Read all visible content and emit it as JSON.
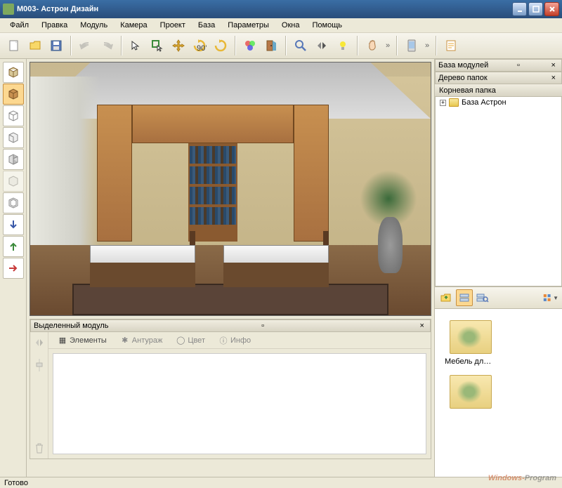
{
  "window": {
    "title": "М003- Астрон Дизайн"
  },
  "menu": {
    "items": [
      "Файл",
      "Правка",
      "Модуль",
      "Камера",
      "Проект",
      "База",
      "Параметры",
      "Окна",
      "Помощь"
    ]
  },
  "toolbar": {
    "new": "new-file",
    "open": "open-file",
    "save": "save-file",
    "undo": "undo",
    "redo": "redo",
    "select": "select",
    "selectbox": "select-box",
    "move": "move",
    "rotate90": "rotate-90",
    "rotate": "rotate",
    "colors": "color-wheel",
    "door": "door",
    "zoomin": "zoom-in",
    "mirror": "mirror",
    "light": "light",
    "hand": "pan-hand",
    "phone": "export-phone",
    "report": "report"
  },
  "left_tools": [
    "view-box",
    "box-solid",
    "box-wire",
    "box-open",
    "box-side",
    "box-transparent",
    "box-hollow",
    "arrow-down",
    "arrow-up",
    "arrow-right"
  ],
  "module_panel": {
    "title": "Выделенный модуль",
    "tabs": [
      "Элементы",
      "Антураж",
      "Цвет",
      "Инфо"
    ]
  },
  "right_panel": {
    "title_modules": "База модулей",
    "title_tree": "Дерево папок",
    "root_label": "Корневая папка",
    "tree_item": "База Астрон",
    "thumbs": [
      "Мебель для д...",
      ""
    ]
  },
  "status": {
    "text": "Готово"
  },
  "watermark": {
    "part1": "Windows-",
    "part2": "Program"
  }
}
